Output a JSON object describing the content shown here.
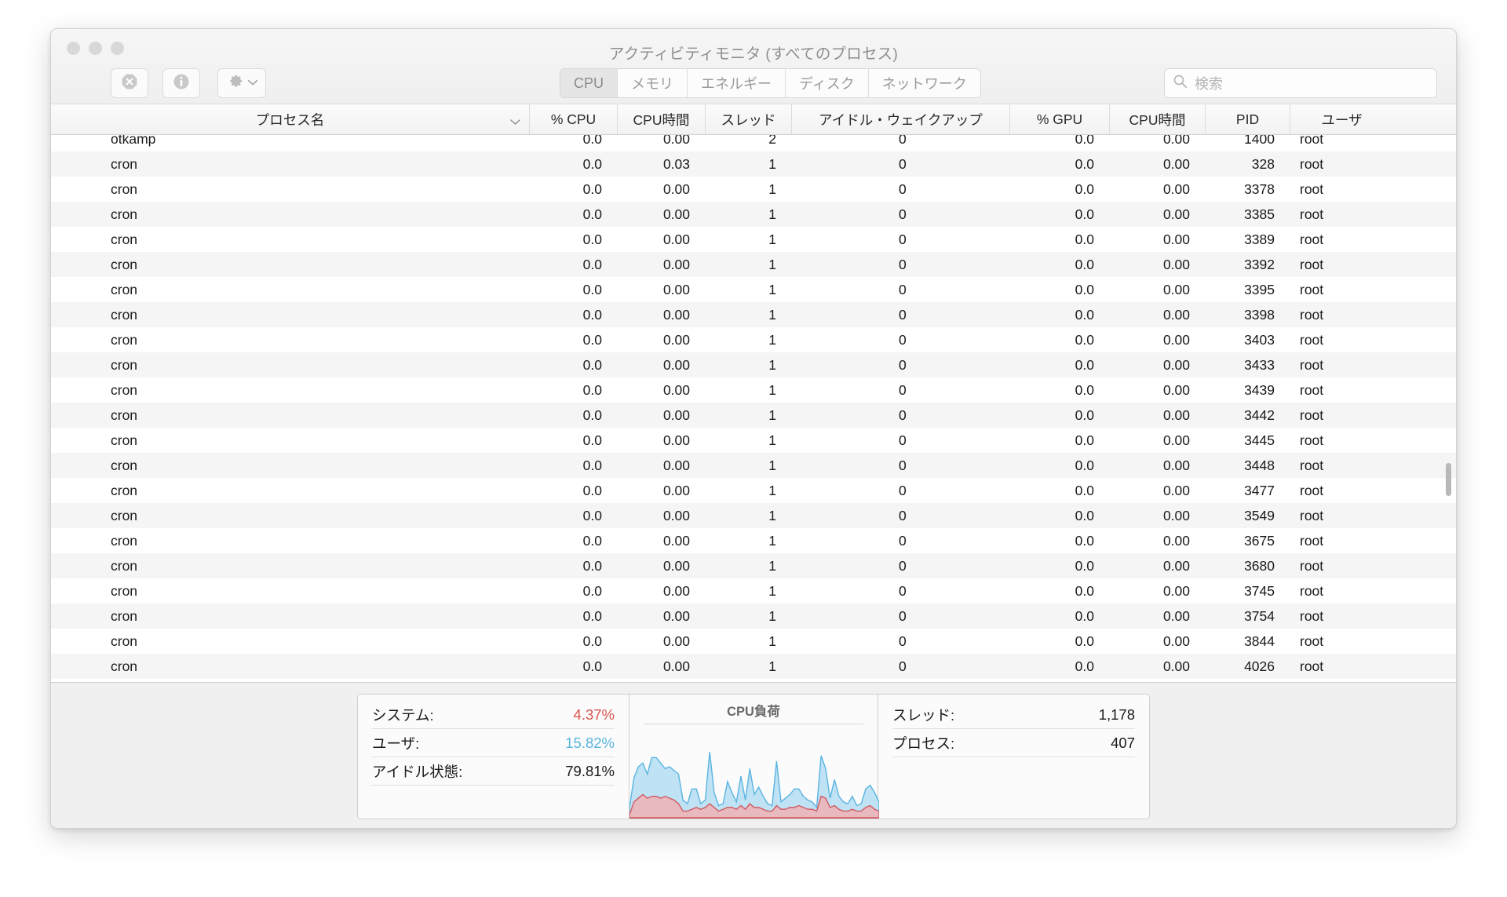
{
  "window": {
    "title": "アクティビティモニタ (すべてのプロセス)",
    "traffic_lights": [
      "close",
      "minimize",
      "zoom"
    ]
  },
  "toolbar": {
    "quit_process_label": "",
    "inspect_label": "",
    "gear_label": "",
    "icons": [
      "stop-process-icon",
      "inspect-process-icon",
      "gear-icon",
      "chevron-down-icon"
    ]
  },
  "tabs": [
    {
      "label": "CPU",
      "selected": true
    },
    {
      "label": "メモリ",
      "selected": false
    },
    {
      "label": "エネルギー",
      "selected": false
    },
    {
      "label": "ディスク",
      "selected": false
    },
    {
      "label": "ネットワーク",
      "selected": false
    }
  ],
  "search": {
    "placeholder": "検索",
    "value": "",
    "icon": "search-icon"
  },
  "table": {
    "columns": [
      {
        "label": "プロセス名",
        "align": "center",
        "sorted": true,
        "sort_icon": "chevron-down-icon"
      },
      {
        "label": "% CPU",
        "align": "center"
      },
      {
        "label": "CPU時間",
        "align": "center"
      },
      {
        "label": "スレッド",
        "align": "center"
      },
      {
        "label": "アイドル・ウェイクアップ",
        "align": "center"
      },
      {
        "label": "% GPU",
        "align": "center"
      },
      {
        "label": "CPU時間",
        "align": "center"
      },
      {
        "label": "PID",
        "align": "center"
      },
      {
        "label": "ユーザ",
        "align": "center"
      }
    ],
    "rows": [
      {
        "name": "otkamp",
        "cpu": "0.0",
        "cpu_time": "0.00",
        "threads": "2",
        "idle_wakeups": "0",
        "gpu": "0.0",
        "gpu_time": "0.00",
        "pid": "1400",
        "user": "root",
        "clipped": true
      },
      {
        "name": "cron",
        "cpu": "0.0",
        "cpu_time": "0.03",
        "threads": "1",
        "idle_wakeups": "0",
        "gpu": "0.0",
        "gpu_time": "0.00",
        "pid": "328",
        "user": "root"
      },
      {
        "name": "cron",
        "cpu": "0.0",
        "cpu_time": "0.00",
        "threads": "1",
        "idle_wakeups": "0",
        "gpu": "0.0",
        "gpu_time": "0.00",
        "pid": "3378",
        "user": "root"
      },
      {
        "name": "cron",
        "cpu": "0.0",
        "cpu_time": "0.00",
        "threads": "1",
        "idle_wakeups": "0",
        "gpu": "0.0",
        "gpu_time": "0.00",
        "pid": "3385",
        "user": "root"
      },
      {
        "name": "cron",
        "cpu": "0.0",
        "cpu_time": "0.00",
        "threads": "1",
        "idle_wakeups": "0",
        "gpu": "0.0",
        "gpu_time": "0.00",
        "pid": "3389",
        "user": "root"
      },
      {
        "name": "cron",
        "cpu": "0.0",
        "cpu_time": "0.00",
        "threads": "1",
        "idle_wakeups": "0",
        "gpu": "0.0",
        "gpu_time": "0.00",
        "pid": "3392",
        "user": "root"
      },
      {
        "name": "cron",
        "cpu": "0.0",
        "cpu_time": "0.00",
        "threads": "1",
        "idle_wakeups": "0",
        "gpu": "0.0",
        "gpu_time": "0.00",
        "pid": "3395",
        "user": "root"
      },
      {
        "name": "cron",
        "cpu": "0.0",
        "cpu_time": "0.00",
        "threads": "1",
        "idle_wakeups": "0",
        "gpu": "0.0",
        "gpu_time": "0.00",
        "pid": "3398",
        "user": "root"
      },
      {
        "name": "cron",
        "cpu": "0.0",
        "cpu_time": "0.00",
        "threads": "1",
        "idle_wakeups": "0",
        "gpu": "0.0",
        "gpu_time": "0.00",
        "pid": "3403",
        "user": "root"
      },
      {
        "name": "cron",
        "cpu": "0.0",
        "cpu_time": "0.00",
        "threads": "1",
        "idle_wakeups": "0",
        "gpu": "0.0",
        "gpu_time": "0.00",
        "pid": "3433",
        "user": "root"
      },
      {
        "name": "cron",
        "cpu": "0.0",
        "cpu_time": "0.00",
        "threads": "1",
        "idle_wakeups": "0",
        "gpu": "0.0",
        "gpu_time": "0.00",
        "pid": "3439",
        "user": "root"
      },
      {
        "name": "cron",
        "cpu": "0.0",
        "cpu_time": "0.00",
        "threads": "1",
        "idle_wakeups": "0",
        "gpu": "0.0",
        "gpu_time": "0.00",
        "pid": "3442",
        "user": "root"
      },
      {
        "name": "cron",
        "cpu": "0.0",
        "cpu_time": "0.00",
        "threads": "1",
        "idle_wakeups": "0",
        "gpu": "0.0",
        "gpu_time": "0.00",
        "pid": "3445",
        "user": "root"
      },
      {
        "name": "cron",
        "cpu": "0.0",
        "cpu_time": "0.00",
        "threads": "1",
        "idle_wakeups": "0",
        "gpu": "0.0",
        "gpu_time": "0.00",
        "pid": "3448",
        "user": "root"
      },
      {
        "name": "cron",
        "cpu": "0.0",
        "cpu_time": "0.00",
        "threads": "1",
        "idle_wakeups": "0",
        "gpu": "0.0",
        "gpu_time": "0.00",
        "pid": "3477",
        "user": "root"
      },
      {
        "name": "cron",
        "cpu": "0.0",
        "cpu_time": "0.00",
        "threads": "1",
        "idle_wakeups": "0",
        "gpu": "0.0",
        "gpu_time": "0.00",
        "pid": "3549",
        "user": "root"
      },
      {
        "name": "cron",
        "cpu": "0.0",
        "cpu_time": "0.00",
        "threads": "1",
        "idle_wakeups": "0",
        "gpu": "0.0",
        "gpu_time": "0.00",
        "pid": "3675",
        "user": "root"
      },
      {
        "name": "cron",
        "cpu": "0.0",
        "cpu_time": "0.00",
        "threads": "1",
        "idle_wakeups": "0",
        "gpu": "0.0",
        "gpu_time": "0.00",
        "pid": "3680",
        "user": "root"
      },
      {
        "name": "cron",
        "cpu": "0.0",
        "cpu_time": "0.00",
        "threads": "1",
        "idle_wakeups": "0",
        "gpu": "0.0",
        "gpu_time": "0.00",
        "pid": "3745",
        "user": "root"
      },
      {
        "name": "cron",
        "cpu": "0.0",
        "cpu_time": "0.00",
        "threads": "1",
        "idle_wakeups": "0",
        "gpu": "0.0",
        "gpu_time": "0.00",
        "pid": "3754",
        "user": "root"
      },
      {
        "name": "cron",
        "cpu": "0.0",
        "cpu_time": "0.00",
        "threads": "1",
        "idle_wakeups": "0",
        "gpu": "0.0",
        "gpu_time": "0.00",
        "pid": "3844",
        "user": "root"
      },
      {
        "name": "cron",
        "cpu": "0.0",
        "cpu_time": "0.00",
        "threads": "1",
        "idle_wakeups": "0",
        "gpu": "0.0",
        "gpu_time": "0.00",
        "pid": "4026",
        "user": "root"
      }
    ]
  },
  "footer": {
    "left_stats": [
      {
        "label": "システム:",
        "value": "4.37%",
        "color": "#d9534f"
      },
      {
        "label": "ユーザ:",
        "value": "15.82%",
        "color": "#5ab4e0"
      },
      {
        "label": "アイドル状態:",
        "value": "79.81%",
        "color": "#1a1a1a"
      }
    ],
    "right_stats": [
      {
        "label": "スレッド:",
        "value": "1,178",
        "color": "#1a1a1a"
      },
      {
        "label": "プロセス:",
        "value": "407",
        "color": "#1a1a1a"
      }
    ],
    "graph_title": "CPU負荷"
  },
  "chart_data": {
    "type": "area",
    "title": "CPU負荷",
    "xlabel": "",
    "ylabel": "",
    "ylim": [
      0,
      100
    ],
    "grid": false,
    "legend": "none",
    "series": [
      {
        "name": "ユーザ",
        "color": "#5ab4e0",
        "fill": "#bfe2f4",
        "values": [
          6,
          22,
          28,
          30,
          24,
          33,
          33,
          30,
          27,
          28,
          26,
          24,
          10,
          8,
          16,
          16,
          8,
          10,
          36,
          14,
          7,
          8,
          20,
          14,
          9,
          23,
          10,
          27,
          13,
          17,
          12,
          8,
          7,
          31,
          9,
          11,
          13,
          16,
          16,
          12,
          10,
          9,
          6,
          34,
          27,
          11,
          21,
          12,
          9,
          8,
          12,
          7,
          8,
          16,
          18,
          14,
          9
        ]
      },
      {
        "name": "システム",
        "color": "#d05a62",
        "fill": "#e8b9be",
        "values": [
          2,
          9,
          11,
          13,
          11,
          12,
          12,
          11,
          12,
          11,
          10,
          8,
          4,
          4,
          5,
          6,
          5,
          6,
          8,
          6,
          4,
          5,
          6,
          6,
          5,
          7,
          5,
          8,
          6,
          6,
          5,
          4,
          4,
          7,
          5,
          5,
          6,
          6,
          7,
          6,
          5,
          5,
          4,
          12,
          11,
          6,
          7,
          5,
          4,
          4,
          5,
          4,
          4,
          6,
          7,
          5,
          4
        ]
      }
    ]
  }
}
